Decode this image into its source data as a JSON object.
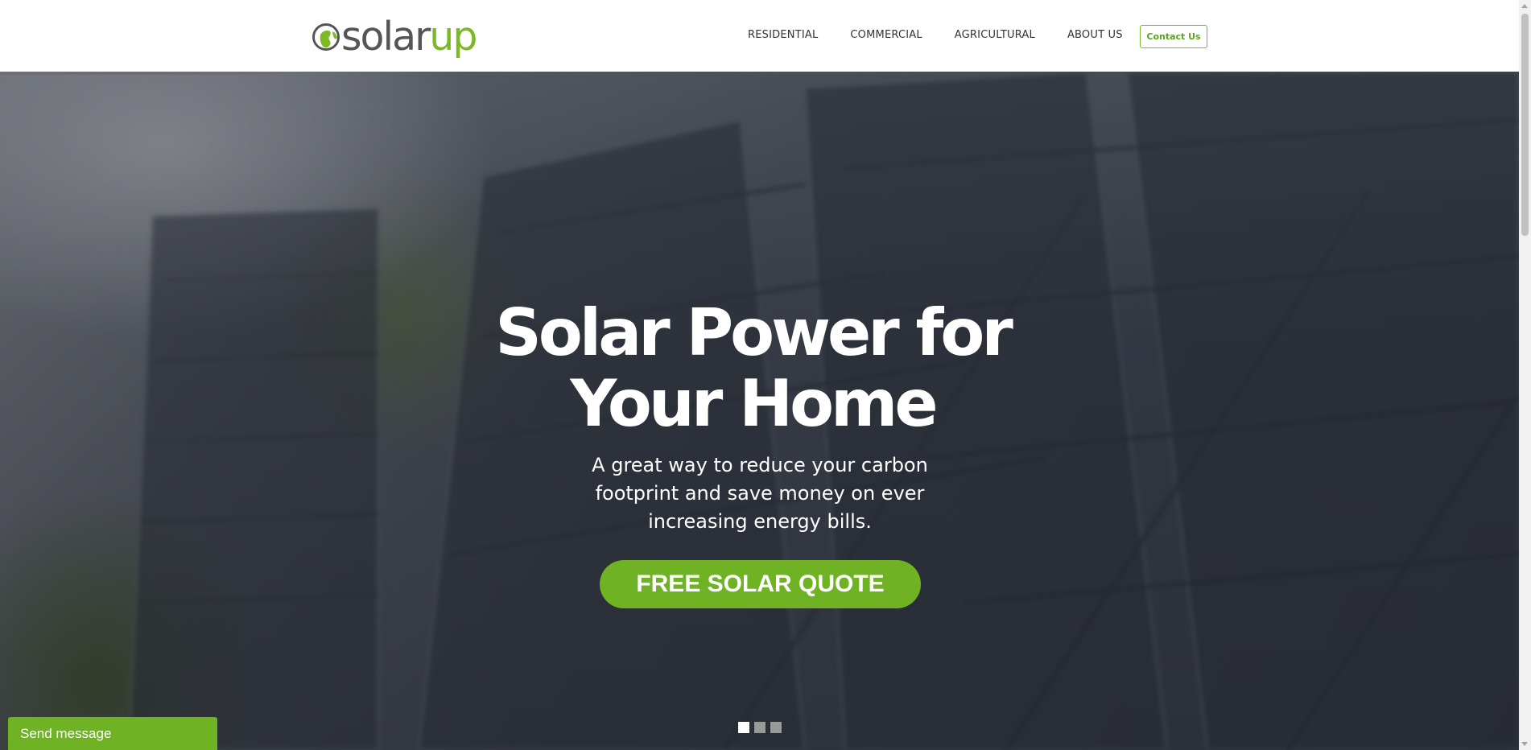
{
  "header": {
    "logo": {
      "part1": "solar",
      "part2": "up"
    },
    "nav": [
      {
        "label": "RESIDENTIAL"
      },
      {
        "label": "COMMERCIAL"
      },
      {
        "label": "AGRICULTURAL"
      },
      {
        "label": "ABOUT US"
      }
    ],
    "contact_label": "Contact Us"
  },
  "hero": {
    "title_line1": "Solar Power for",
    "title_line2": "Your Home",
    "subtitle": "A great way to reduce your carbon footprint and save money on ever increasing energy bills.",
    "cta_label": "FREE SOLAR QUOTE",
    "slides": {
      "count": 3,
      "active": 1
    }
  },
  "chat": {
    "label": "Send message"
  },
  "colors": {
    "brand_green": "#7bba25",
    "cta_green": "#6fb324",
    "logo_grey": "#555555"
  }
}
